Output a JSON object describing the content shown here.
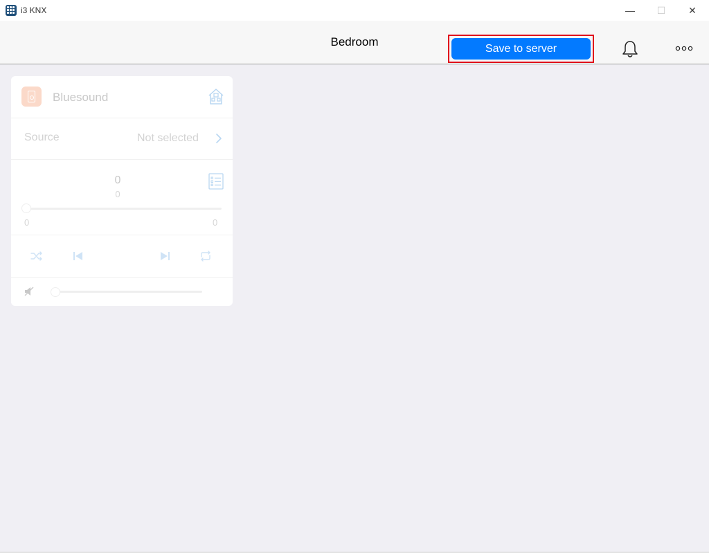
{
  "window": {
    "title": "i3 KNX",
    "minimize_glyph": "—",
    "maximize_glyph": "☐",
    "close_glyph": "✕"
  },
  "header": {
    "title": "Bedroom",
    "save_label": "Save to server",
    "bell_icon": "bell-icon",
    "more_icon": "more-dots-icon"
  },
  "device": {
    "name": "Bluesound",
    "icon": "speaker-icon",
    "icon_color": "#fbd9c9",
    "source_label": "Source",
    "source_value": "Not selected",
    "track_title": "0",
    "track_subtitle": "0",
    "time_elapsed": "0",
    "time_total": "0",
    "progress": 0,
    "volume": 0
  },
  "colors": {
    "accent": "#037aff",
    "highlight_border": "#e0001b",
    "disabled_icon": "#b9d7f2"
  }
}
